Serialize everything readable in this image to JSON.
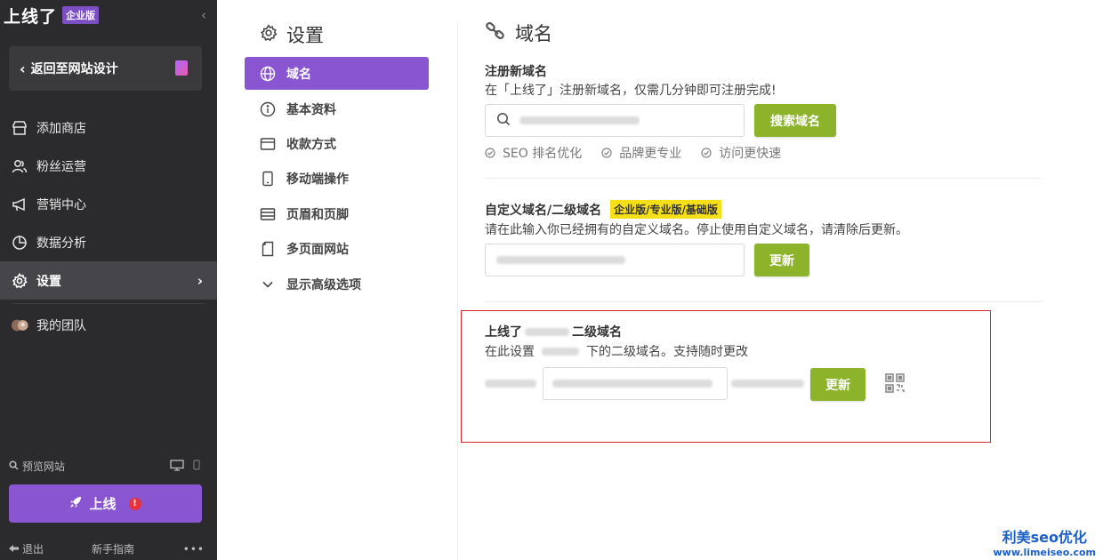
{
  "brand": {
    "name": "上线了",
    "badge": "企业版"
  },
  "back_button": "返回至网站设计",
  "nav": [
    {
      "label": "添加商店",
      "icon": "store-icon"
    },
    {
      "label": "粉丝运营",
      "icon": "users-icon"
    },
    {
      "label": "营销中心",
      "icon": "megaphone-icon"
    },
    {
      "label": "数据分析",
      "icon": "pie-chart-icon"
    },
    {
      "label": "设置",
      "icon": "gear-icon",
      "active": true
    }
  ],
  "team": {
    "label": "我的团队"
  },
  "preview_label": "预览网站",
  "launch_label": "上线",
  "launch_warning": "!",
  "footer": {
    "logout": "退出",
    "guide": "新手指南",
    "more": "•••"
  },
  "settings": {
    "title": "设置",
    "items": [
      {
        "label": "域名",
        "icon": "globe-icon",
        "active": true
      },
      {
        "label": "基本资料",
        "icon": "info-icon"
      },
      {
        "label": "收款方式",
        "icon": "wallet-icon"
      },
      {
        "label": "移动端操作",
        "icon": "mobile-icon"
      },
      {
        "label": "页眉和页脚",
        "icon": "layout-icon"
      },
      {
        "label": "多页面网站",
        "icon": "pages-icon"
      },
      {
        "label": "显示高级选项",
        "icon": "chevron-down-icon"
      }
    ]
  },
  "main": {
    "title": "域名",
    "register": {
      "title": "注册新域名",
      "desc": "在「上线了」注册新域名，仅需几分钟即可注册完成!",
      "search_button": "搜索域名",
      "features": [
        "SEO 排名优化",
        "品牌更专业",
        "访问更快速"
      ]
    },
    "custom": {
      "title": "自定义域名/二级域名",
      "tag": "企业版/专业版/基础版",
      "desc": "请在此输入你已经拥有的自定义域名。停止使用自定义域名，请清除后更新。",
      "update_button": "更新"
    },
    "subdomain": {
      "title_prefix": "上线了",
      "title_suffix": "二级域名",
      "desc_prefix": "在此设置",
      "desc_suffix": "下的二级域名。支持随时更改",
      "update_button": "更新"
    }
  },
  "watermark": {
    "main": "利美seo优化",
    "sub": "www.limeiseo.com"
  },
  "colors": {
    "sidebar": "#2b2b2d",
    "accent": "#8a55d1",
    "green": "#8db32a",
    "highlight": "#f5df18",
    "box": "#d9272e"
  }
}
